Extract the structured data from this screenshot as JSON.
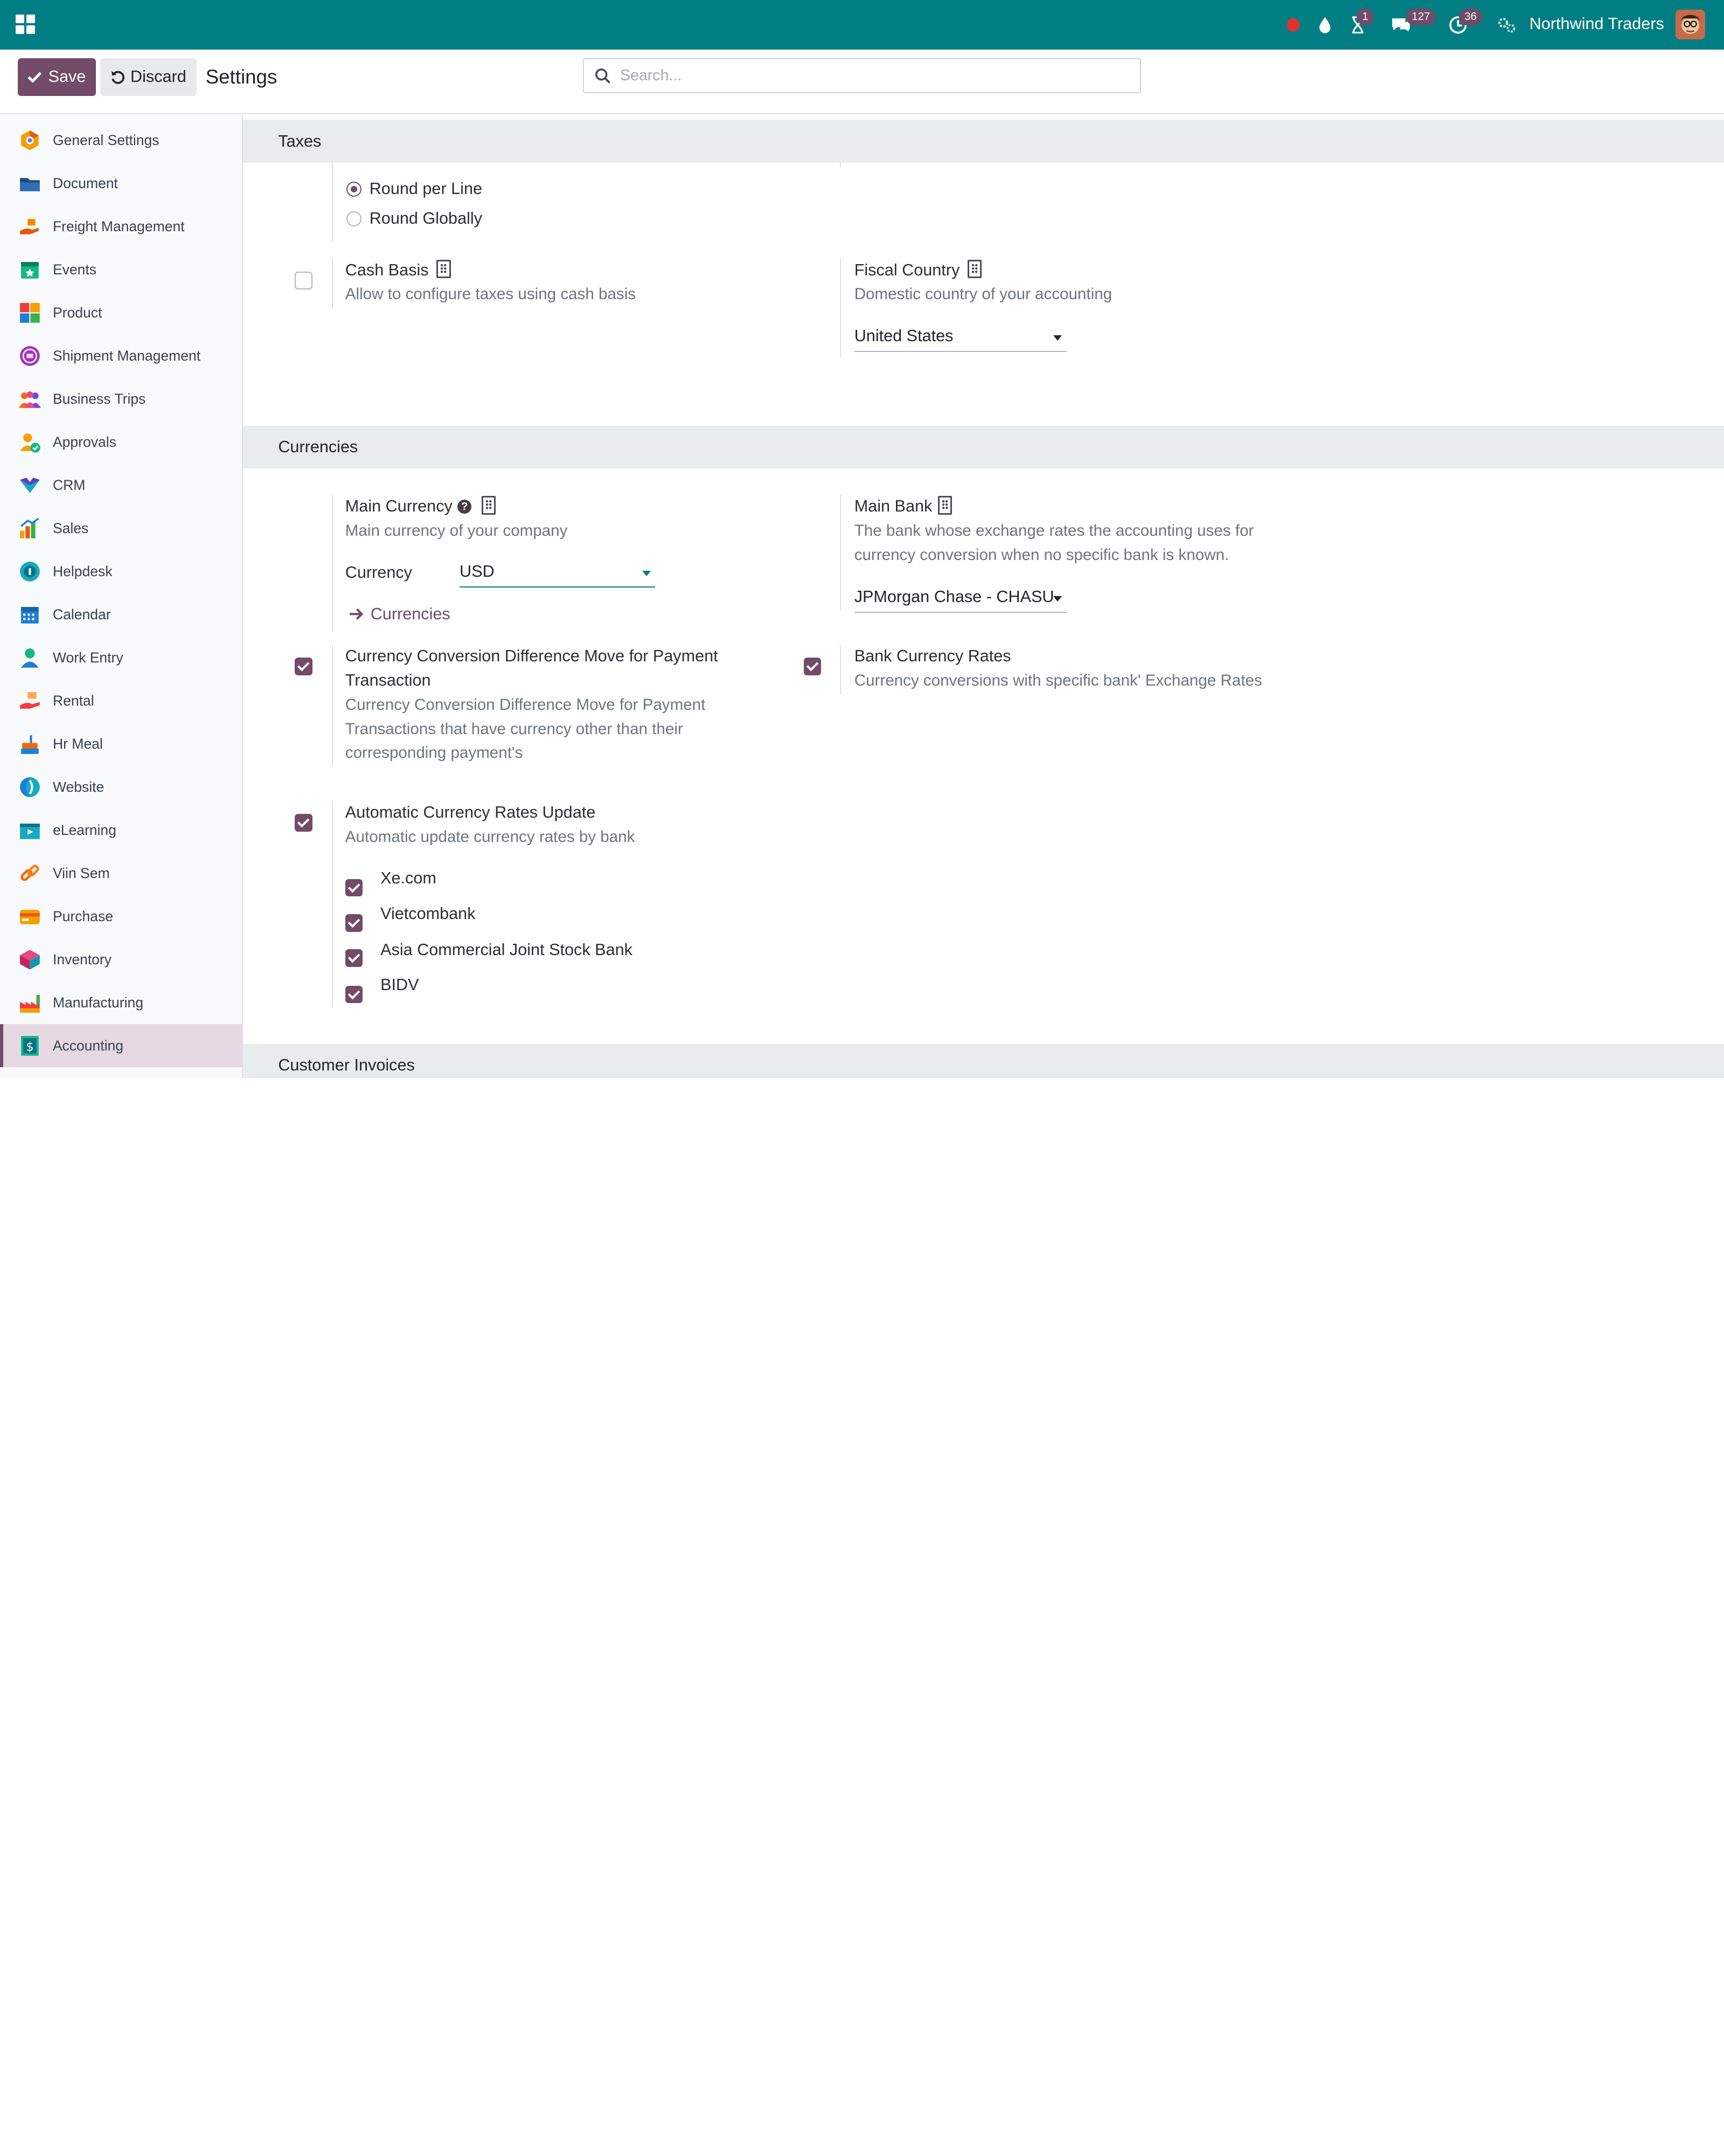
{
  "navbar": {
    "company": "Northwind Traders",
    "activity_badge": "1",
    "messages_badge": "127",
    "clock_badge": "36",
    "colors": {
      "bar": "#017e84",
      "badge": "#714b67",
      "record": "#e03131"
    }
  },
  "control_panel": {
    "save_label": "Save",
    "discard_label": "Discard",
    "title": "Settings",
    "search_placeholder": "Search..."
  },
  "sidebar": {
    "items": [
      {
        "label": "General Settings",
        "icon": "general-settings-icon"
      },
      {
        "label": "Document",
        "icon": "document-icon"
      },
      {
        "label": "Freight Management",
        "icon": "freight-icon"
      },
      {
        "label": "Events",
        "icon": "events-icon"
      },
      {
        "label": "Product",
        "icon": "product-icon"
      },
      {
        "label": "Shipment Management",
        "icon": "shipment-icon"
      },
      {
        "label": "Business Trips",
        "icon": "business-trips-icon"
      },
      {
        "label": "Approvals",
        "icon": "approvals-icon"
      },
      {
        "label": "CRM",
        "icon": "crm-icon"
      },
      {
        "label": "Sales",
        "icon": "sales-icon"
      },
      {
        "label": "Helpdesk",
        "icon": "helpdesk-icon"
      },
      {
        "label": "Calendar",
        "icon": "calendar-icon"
      },
      {
        "label": "Work Entry",
        "icon": "work-entry-icon"
      },
      {
        "label": "Rental",
        "icon": "rental-icon"
      },
      {
        "label": "Hr Meal",
        "icon": "hr-meal-icon"
      },
      {
        "label": "Website",
        "icon": "website-icon"
      },
      {
        "label": "eLearning",
        "icon": "elearning-icon"
      },
      {
        "label": "Viin Sem",
        "icon": "viin-sem-icon"
      },
      {
        "label": "Purchase",
        "icon": "purchase-icon"
      },
      {
        "label": "Inventory",
        "icon": "inventory-icon"
      },
      {
        "label": "Manufacturing",
        "icon": "manufacturing-icon"
      },
      {
        "label": "Accounting",
        "icon": "accounting-icon",
        "active": true
      }
    ]
  },
  "taxes": {
    "heading": "Taxes",
    "round_per_line": "Round per Line",
    "round_globally": "Round Globally",
    "rounding_selected": "Round per Line",
    "cash_basis": {
      "label": "Cash Basis",
      "desc": "Allow to configure taxes using cash basis",
      "checked": false
    },
    "fiscal_country": {
      "label": "Fiscal Country",
      "desc": "Domestic country of your accounting",
      "value": "United States"
    }
  },
  "currencies": {
    "heading": "Currencies",
    "main_currency": {
      "label": "Main Currency",
      "desc": "Main currency of your company",
      "field_label": "Currency",
      "value": "USD",
      "link": "Currencies"
    },
    "main_bank": {
      "label": "Main Bank",
      "desc_1": "The bank whose exchange rates the accounting uses for",
      "desc_2": "currency conversion when no specific bank is known.",
      "value": "JPMorgan Chase - CHASU"
    },
    "conversion_diff": {
      "label_1": "Currency Conversion Difference Move for Payment",
      "label_2": "Transaction",
      "desc_1": "Currency Conversion Difference Move for Payment",
      "desc_2": "Transactions that have currency other than their",
      "desc_3": "corresponding payment's",
      "checked": true
    },
    "bank_rates": {
      "label": "Bank Currency Rates",
      "desc": "Currency conversions with specific bank' Exchange Rates",
      "checked": true
    },
    "auto_update": {
      "label": "Automatic Currency Rates Update",
      "desc": "Automatic update currency rates by bank",
      "checked": true,
      "banks": [
        {
          "label": "Xe.com",
          "checked": true
        },
        {
          "label": "Vietcombank",
          "checked": true
        },
        {
          "label": "Asia Commercial Joint Stock Bank",
          "checked": true
        },
        {
          "label": "BIDV",
          "checked": true
        }
      ]
    }
  },
  "customer_invoices": {
    "heading": "Customer Invoices"
  }
}
